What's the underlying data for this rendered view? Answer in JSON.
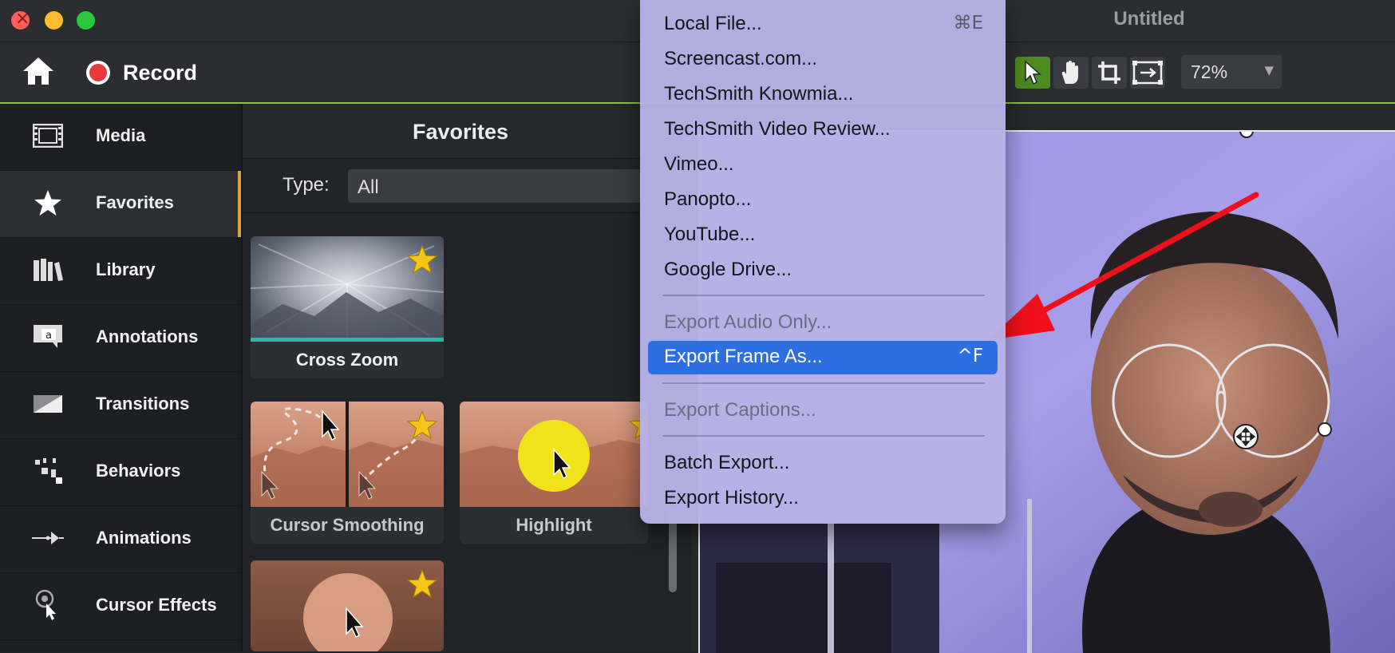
{
  "window": {
    "title": "Untitled"
  },
  "toolbar": {
    "record_label": "Record",
    "zoom": "72%"
  },
  "sidebar": {
    "items": [
      {
        "label": "Media",
        "icon": "film-icon"
      },
      {
        "label": "Favorites",
        "icon": "star-icon"
      },
      {
        "label": "Library",
        "icon": "books-icon"
      },
      {
        "label": "Annotations",
        "icon": "annotation-icon"
      },
      {
        "label": "Transitions",
        "icon": "transition-icon"
      },
      {
        "label": "Behaviors",
        "icon": "behaviors-icon"
      },
      {
        "label": "Animations",
        "icon": "animation-icon"
      },
      {
        "label": "Cursor Effects",
        "icon": "cursor-effects-icon"
      }
    ]
  },
  "panel": {
    "title": "Favorites",
    "type_label": "Type:",
    "type_value": "All",
    "assets": [
      {
        "label": "Cross Zoom"
      },
      {
        "label": "Cursor Smoothing"
      },
      {
        "label": "Highlight"
      }
    ]
  },
  "menu": {
    "items": [
      {
        "label": "Local File...",
        "shortcut": "⌘E"
      },
      {
        "label": "Screencast.com..."
      },
      {
        "label": "TechSmith Knowmia..."
      },
      {
        "label": "TechSmith Video Review..."
      },
      {
        "label": "Vimeo..."
      },
      {
        "label": "Panopto..."
      },
      {
        "label": "YouTube..."
      },
      {
        "label": "Google Drive..."
      },
      {
        "label": "Export Audio Only..."
      },
      {
        "label": "Export Frame As...",
        "shortcut": "^F"
      },
      {
        "label": "Export Captions..."
      },
      {
        "label": "Batch Export..."
      },
      {
        "label": "Export History..."
      }
    ]
  },
  "colors": {
    "accent_green": "#8cc43c",
    "selection_blue": "#2d6fe0",
    "favorite_star": "#f5c518",
    "record_red": "#e83a3a"
  }
}
